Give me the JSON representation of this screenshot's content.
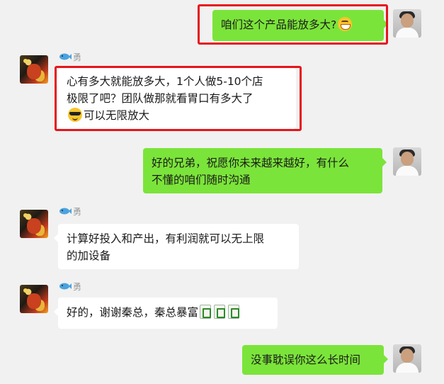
{
  "sender_name": "勇",
  "messages": [
    {
      "text": "咱们这个产品能放多大?",
      "emoji": "grinning-face-icon"
    },
    {
      "line1": "心有多大就能放多大，1个人做5-10个店",
      "line2": "极限了吧？团队做那就看胃口有多大了",
      "line3": "可以无限放大",
      "emoji": "sunglasses-face-icon"
    },
    {
      "line1": "好的兄弟，祝愿你未来越来越好，有什么",
      "line2": "不懂的咱们随时沟通"
    },
    {
      "line1": "计算好投入和产出，有利润就可以无上限",
      "line2": "的加设备"
    },
    {
      "text": "好的，谢谢秦总，秦总暴富",
      "emoji": "mahjong-tile-icon"
    },
    {
      "text": "没事耽误你这么长时间"
    }
  ],
  "colors": {
    "my_bubble": "#7be43a",
    "other_bubble": "#ffffff",
    "highlight": "#e7141b",
    "background": "#f1f1f1"
  }
}
